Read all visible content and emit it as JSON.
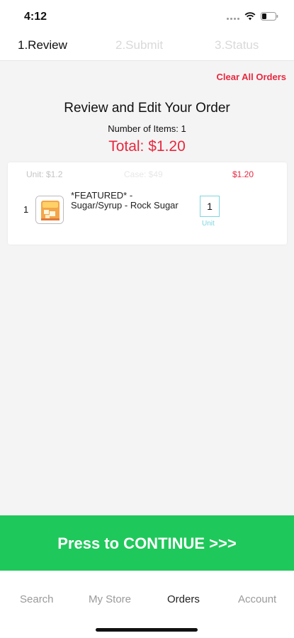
{
  "status_bar": {
    "time": "4:12"
  },
  "tabs": [
    {
      "label": "1.Review",
      "active": true
    },
    {
      "label": "2.Submit",
      "active": false
    },
    {
      "label": "3.Status",
      "active": false
    }
  ],
  "clear_all_label": "Clear All Orders",
  "review": {
    "title": "Review and Edit Your Order",
    "item_count": "Number of Items: 1",
    "total": "Total: $1.20"
  },
  "order_item": {
    "unit_price": "Unit: $1.2",
    "case_price": "Case: $49",
    "line_price": "$1.20",
    "line_number": "1",
    "product_name": "*FEATURED* - Sugar/Syrup - Rock Sugar",
    "quantity": "1",
    "quantity_unit": "Unit"
  },
  "continue_label": "Press to CONTINUE >>>",
  "bottom_nav": [
    {
      "label": "Search",
      "active": false
    },
    {
      "label": "My Store",
      "active": false
    },
    {
      "label": "Orders",
      "active": true
    },
    {
      "label": "Account",
      "active": false
    }
  ],
  "colors": {
    "accent_red": "#e8283f",
    "continue_green": "#1fc85a",
    "quantity_teal": "#7dd6df"
  }
}
